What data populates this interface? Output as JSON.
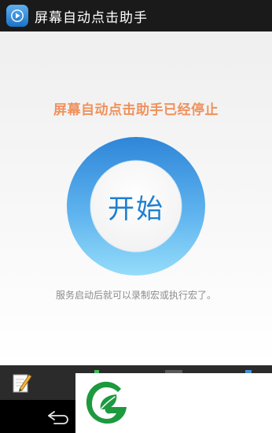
{
  "app": {
    "title": "屏幕自动点击助手",
    "icon": "play-icon"
  },
  "main": {
    "status_text": "屏幕自动点击助手已经停止",
    "start_button_label": "开始",
    "hint_text": "服务启动后就可以录制宏或执行宏了。"
  },
  "toolbar": {
    "edit_icon": "pencil-notepad-icon"
  },
  "navbar": {
    "back_icon": "back-arrow-icon"
  },
  "overlay": {
    "logo_icon": "leaf-g-logo-icon"
  },
  "colors": {
    "status_text": "#f0915c",
    "start_text": "#1e7fd2",
    "ring": "#4fa5e6",
    "logo_green": "#1d9a3e"
  }
}
